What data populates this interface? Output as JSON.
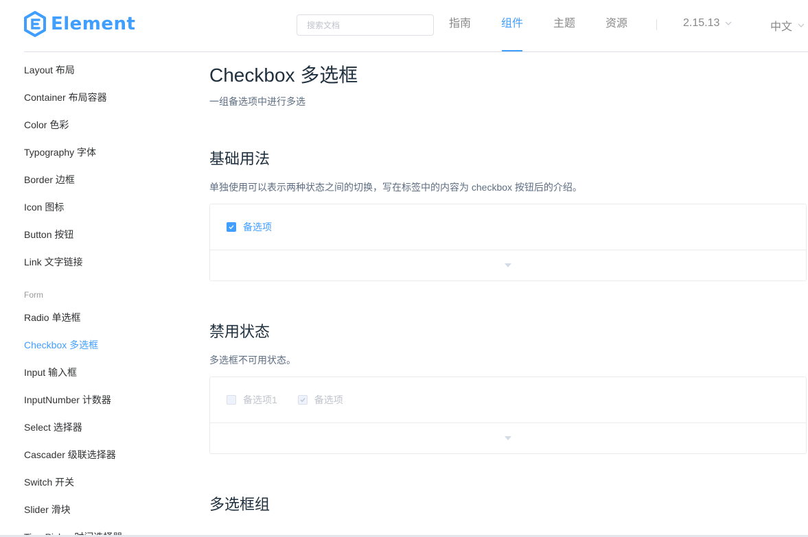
{
  "header": {
    "logo_text": "Element",
    "search_placeholder": "搜索文档",
    "nav": [
      "指南",
      "组件",
      "主题",
      "资源"
    ],
    "active_nav": "组件",
    "version": "2.15.13",
    "language": "中文"
  },
  "sidebar": {
    "items_top": [
      "Layout 布局",
      "Container 布局容器",
      "Color 色彩",
      "Typography 字体",
      "Border 边框",
      "Icon 图标",
      "Button 按钮",
      "Link 文字链接"
    ],
    "group_form": "Form",
    "items_form": [
      "Radio 单选框",
      "Checkbox 多选框",
      "Input 输入框",
      "InputNumber 计数器",
      "Select 选择器",
      "Cascader 级联选择器",
      "Switch 开关",
      "Slider 滑块",
      "TimePicker 时间选择器"
    ],
    "active": "Checkbox 多选框"
  },
  "main": {
    "title": "Checkbox 多选框",
    "desc": "一组备选项中进行多选",
    "sections": [
      {
        "title": "基础用法",
        "desc": "单独使用可以表示两种状态之间的切换，写在标签中的内容为 checkbox 按钮后的介绍。",
        "checkboxes": [
          {
            "label": "备选项",
            "checked": true,
            "disabled": false
          }
        ]
      },
      {
        "title": "禁用状态",
        "desc": "多选框不可用状态。",
        "checkboxes": [
          {
            "label": "备选项1",
            "checked": false,
            "disabled": true
          },
          {
            "label": "备选项",
            "checked": true,
            "disabled": true
          }
        ]
      },
      {
        "title": "多选框组"
      }
    ]
  },
  "colors": {
    "primary": "#409eff",
    "text": "#303133",
    "muted": "#5e6d82",
    "disabled": "#c0c4cc"
  }
}
